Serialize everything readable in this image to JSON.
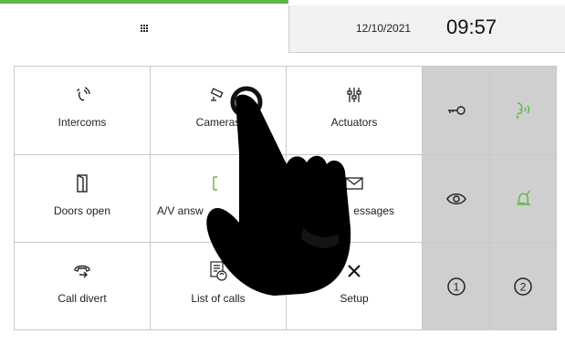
{
  "header": {
    "menu_icon": "grid-menu-icon",
    "date": "12/10/2021",
    "time": "09:57",
    "accent_color": "#62b544"
  },
  "menu": [
    {
      "label": "Intercoms",
      "icon": "intercom-icon"
    },
    {
      "label": "Cameras",
      "icon": "camera-icon"
    },
    {
      "label": "Actuators",
      "icon": "actuators-icon"
    },
    {
      "label": "Doors open",
      "icon": "door-icon"
    },
    {
      "label": "A/V answ",
      "icon": "answering-machine-icon"
    },
    {
      "label": "essages",
      "icon": "envelope-icon"
    },
    {
      "label": "Call divert",
      "icon": "call-divert-icon"
    },
    {
      "label": "List of calls",
      "icon": "call-list-icon"
    },
    {
      "label": "Setup",
      "icon": "setup-tools-icon"
    }
  ],
  "quick_actions": [
    {
      "icon": "key-icon"
    },
    {
      "icon": "answer-voice-icon",
      "color": "#62b544"
    },
    {
      "icon": "eye-icon"
    },
    {
      "icon": "bell-icon",
      "color": "#62b544"
    },
    {
      "icon": "number-one-icon",
      "label": "1"
    },
    {
      "icon": "number-two-icon",
      "label": "2"
    }
  ],
  "overlay": {
    "icon": "pointing-hand-icon"
  },
  "colors": {
    "quick_bg": "#cfcfcf",
    "grid_border": "#c8c8c8",
    "tab_bg": "#f2f2f2"
  }
}
